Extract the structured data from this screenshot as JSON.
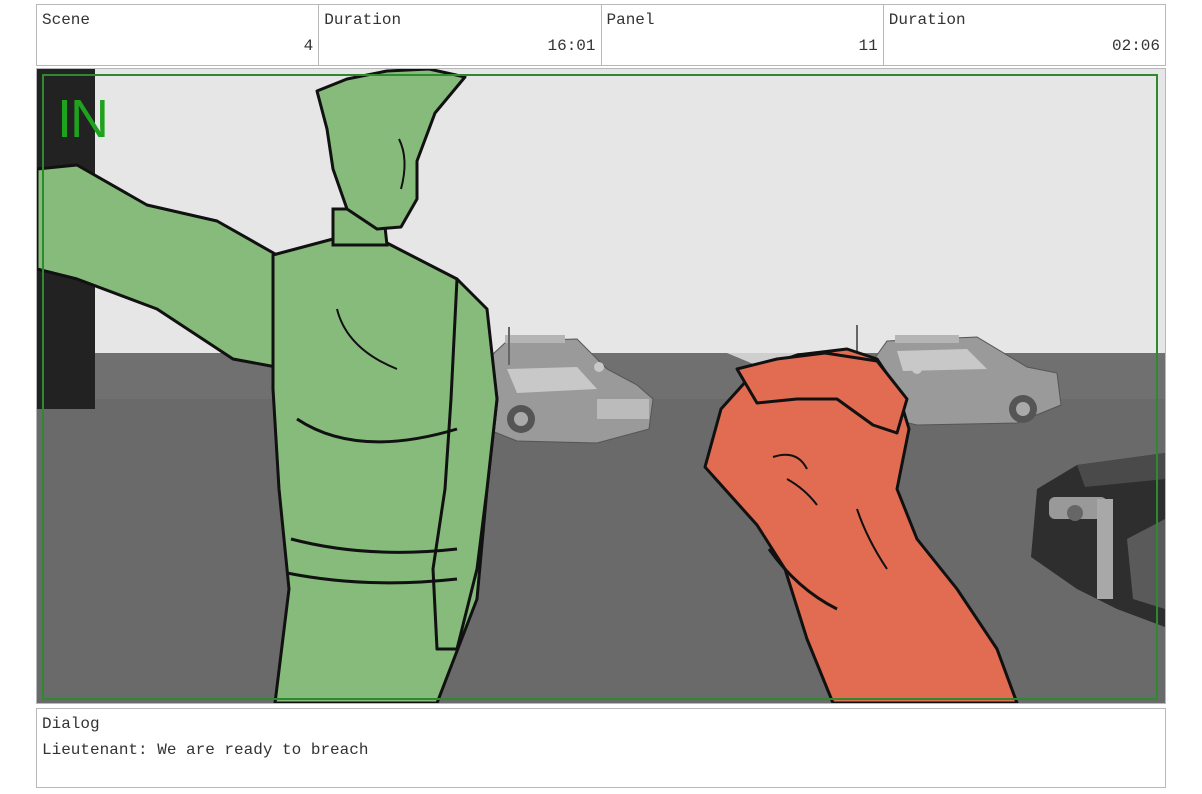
{
  "header": {
    "scene_label": "Scene",
    "scene_value": "4",
    "scene_duration_label": "Duration",
    "scene_duration_value": "16:01",
    "panel_label": "Panel",
    "panel_value": "11",
    "panel_duration_label": "Duration",
    "panel_duration_value": "02:06"
  },
  "panel": {
    "transition_marker": "IN",
    "marker_color": "#1fa31f",
    "green_character_color": "#87bb7c",
    "red_character_color": "#e26c52"
  },
  "dialog": {
    "label": "Dialog",
    "text": "Lieutenant: We are ready to breach"
  }
}
